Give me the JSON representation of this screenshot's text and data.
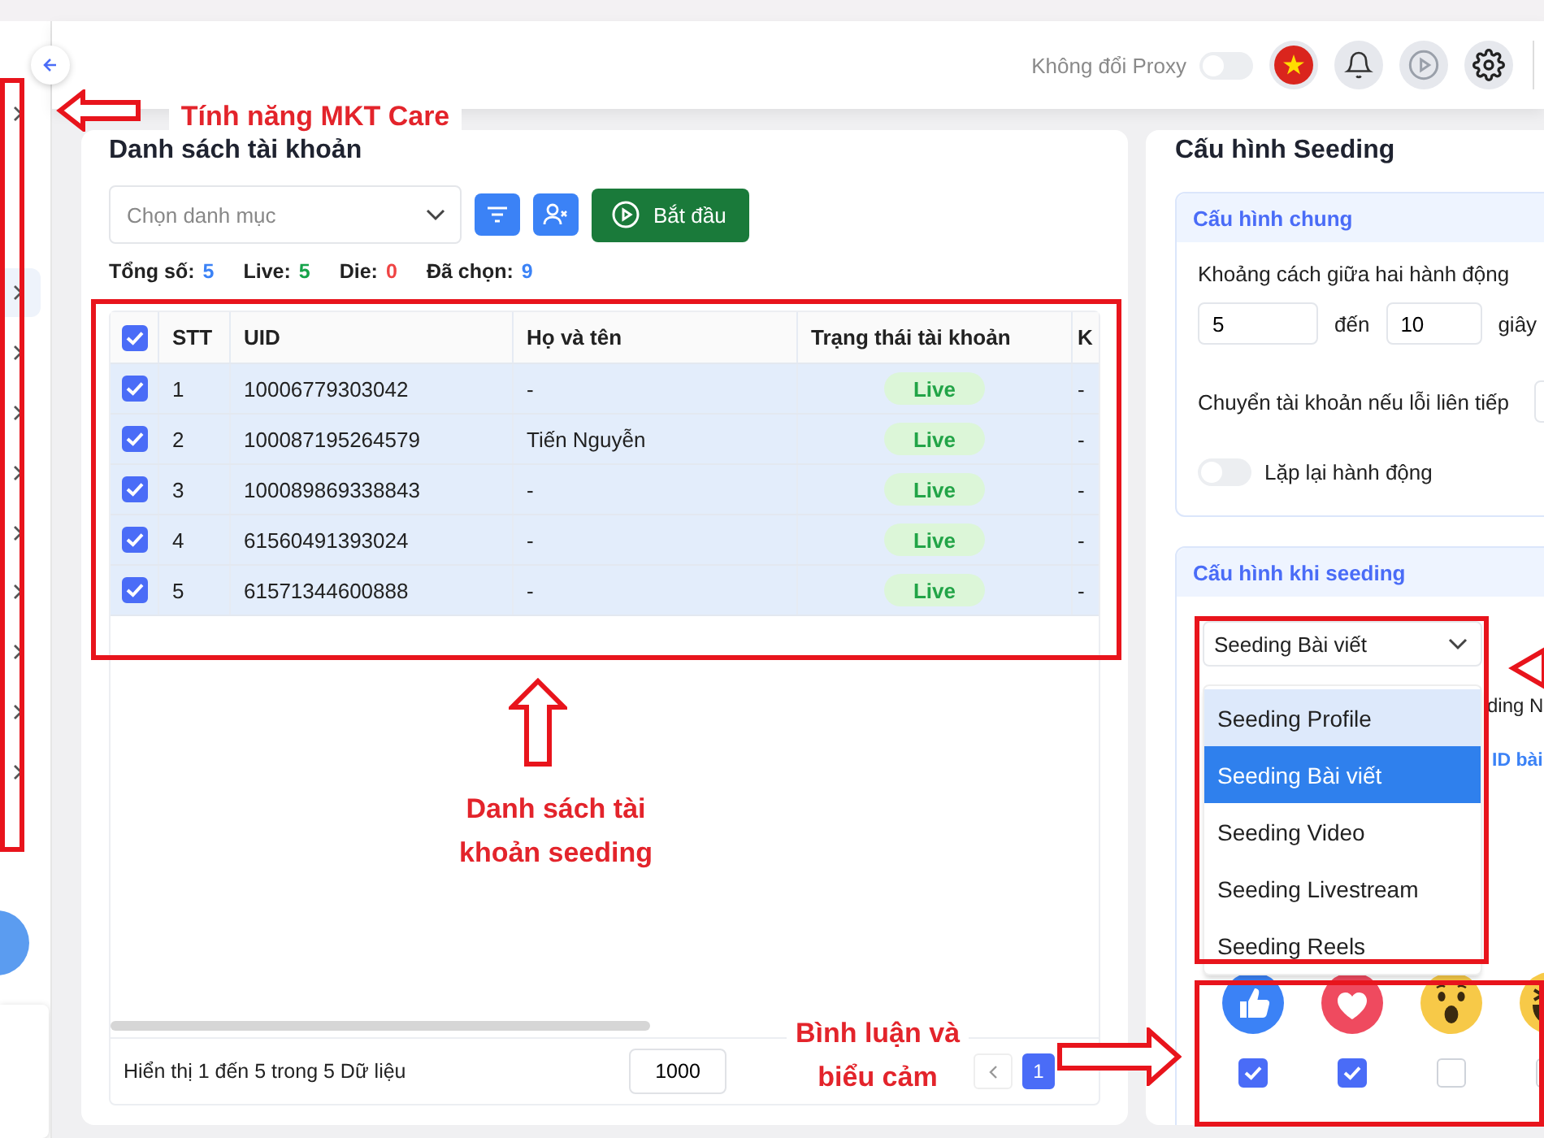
{
  "header": {
    "proxy_label": "Không đổi Proxy",
    "proxy_toggle": {
      "on": false
    }
  },
  "sidebar": {
    "items": [
      {
        "selected": false
      },
      {
        "selected": true
      },
      {
        "selected": false
      },
      {
        "selected": false
      },
      {
        "selected": false
      },
      {
        "selected": false
      },
      {
        "selected": false
      },
      {
        "selected": false
      },
      {
        "selected": false
      },
      {
        "selected": false
      }
    ]
  },
  "accounts": {
    "title": "Danh sách tài khoản",
    "category_select": {
      "placeholder": "Chọn danh mục"
    },
    "start_button": "Bắt đầu",
    "counts": [
      {
        "label": "Tổng số:",
        "value": "5",
        "color": "#3b82f6"
      },
      {
        "label": "Live:",
        "value": "5",
        "color": "#16a34a"
      },
      {
        "label": "Die:",
        "value": "0",
        "color": "#ef4444"
      },
      {
        "label": "Đã chọn:",
        "value": "9",
        "color": "#3b82f6"
      }
    ],
    "table": {
      "select_all": {
        "checked": true
      },
      "columns": [
        "STT",
        "UID",
        "Họ và tên",
        "Trạng thái tài khoản",
        "K"
      ],
      "rows": [
        {
          "checked": true,
          "stt": "1",
          "uid": "10006779303042",
          "name": "-",
          "status": "Live",
          "column_6": "-"
        },
        {
          "checked": true,
          "stt": "2",
          "uid": "100087195264579",
          "name": "Tiến Nguyễn",
          "status": "Live",
          "column_6": "-"
        },
        {
          "checked": true,
          "stt": "3",
          "uid": "100089869338843",
          "name": "-",
          "status": "Live",
          "column_6": "-"
        },
        {
          "checked": true,
          "stt": "4",
          "uid": "61560491393024",
          "name": "-",
          "status": "Live",
          "column_6": "-"
        },
        {
          "checked": true,
          "stt": "5",
          "uid": "61571344600888",
          "name": "-",
          "status": "Live",
          "column_6": "-"
        }
      ]
    },
    "footer": {
      "summary": "Hiển thị 1 đến 5 trong 5 Dữ liệu",
      "page_size": "1000",
      "pages": [
        {
          "label": "1",
          "selected": true
        }
      ]
    }
  },
  "seeding": {
    "title": "Cấu hình Seeding",
    "general": {
      "title": "Cấu hình chung",
      "interval_label": "Khoảng cách giữa hai hành động",
      "from": "5",
      "to_label": "đến",
      "to": "10",
      "unit": "giây",
      "switch_label": "Chuyển tài khoản nếu lỗi liên tiếp",
      "repeat": {
        "label": "Lặp lại hành động",
        "on": false
      }
    },
    "on_seeding": {
      "title": "Cấu hình khi seeding",
      "type_select": {
        "value": "Seeding Bài viết",
        "expanded": true
      },
      "options": [
        {
          "label": "Seeding Profile",
          "selected": false,
          "hovered": true
        },
        {
          "label": "Seeding Bài viết",
          "selected": true,
          "hovered": false
        },
        {
          "label": "Seeding Video",
          "selected": false,
          "hovered": false
        },
        {
          "label": "Seeding Livestream",
          "selected": false,
          "hovered": false
        },
        {
          "label": "Seeding Reels",
          "selected": false,
          "hovered": false
        }
      ],
      "partial_label": "ding N",
      "partial_tab": "ID bài",
      "reactions": [
        {
          "kind": "like",
          "checked": true
        },
        {
          "kind": "love",
          "checked": true
        },
        {
          "kind": "wow",
          "checked": false
        },
        {
          "kind": "haha",
          "checked": false
        }
      ]
    }
  },
  "annotations": [
    {
      "text": "Tính năng MKT Care"
    },
    {
      "text": "Danh sách tài khoản seeding"
    },
    {
      "text": "Bình luận và biểu cảm"
    }
  ]
}
